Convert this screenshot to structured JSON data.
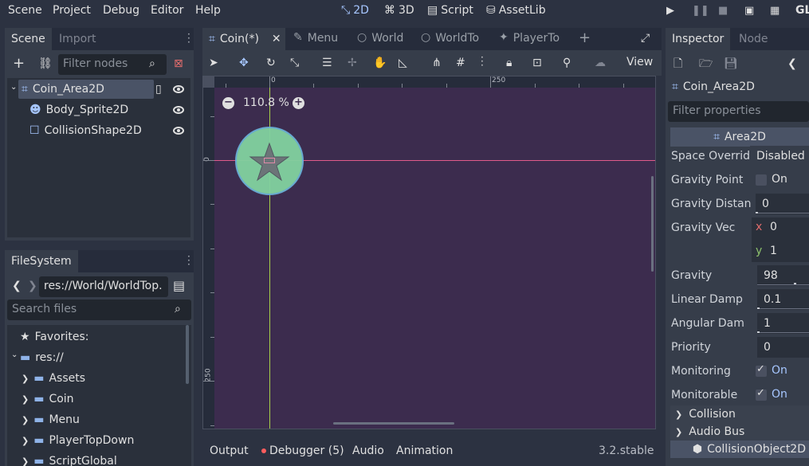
{
  "menu": [
    "Scene",
    "Project",
    "Debug",
    "Editor",
    "Help"
  ],
  "workspaces": [
    {
      "label": "2D",
      "icon": "2d-icon",
      "active": true
    },
    {
      "label": "3D",
      "icon": "3d-icon",
      "active": false
    },
    {
      "label": "Script",
      "icon": "script-icon",
      "active": false
    },
    {
      "label": "AssetLib",
      "icon": "assetlib-icon",
      "active": false
    }
  ],
  "renderer": "GL",
  "scene_dock": {
    "tabs": [
      "Scene",
      "Import"
    ],
    "filter_placeholder": "Filter nodes",
    "tree": [
      {
        "label": "Coin_Area2D",
        "depth": 0,
        "selected": true
      },
      {
        "label": "Body_Sprite2D",
        "depth": 1
      },
      {
        "label": "CollisionShape2D",
        "depth": 1
      }
    ]
  },
  "filesystem": {
    "tab": "FileSystem",
    "path": "res://World/WorldTop.",
    "search_placeholder": "Search files",
    "favorites": "Favorites:",
    "root": "res://",
    "folders": [
      "Assets",
      "Coin",
      "Menu",
      "PlayerTopDown",
      "ScriptGlobal"
    ]
  },
  "editor_tabs": [
    {
      "label": "Coin(*)",
      "active": true
    },
    {
      "label": "Menu",
      "active": false
    },
    {
      "label": "World",
      "active": false
    },
    {
      "label": "WorldTo",
      "active": false
    },
    {
      "label": "PlayerTo",
      "active": false
    }
  ],
  "toolbar": {
    "view_label": "View"
  },
  "viewport": {
    "zoom": "110.8 %",
    "ruler_top": [
      "0",
      "250"
    ],
    "ruler_left": [
      "0",
      "250"
    ]
  },
  "bottom": {
    "tabs": [
      "Output",
      "Debugger (5)",
      "Audio",
      "Animation"
    ],
    "version": "3.2.stable",
    "debugger_color": "#ff5d5d"
  },
  "inspector": {
    "tabs": [
      "Inspector",
      "Node"
    ],
    "node_name": "Coin_Area2D",
    "filter_placeholder": "Filter properties",
    "class_name": "Area2D",
    "props": {
      "space_override": {
        "label": "Space Overrid",
        "value": "Disabled"
      },
      "gravity_point": {
        "label": "Gravity Point",
        "value": "On"
      },
      "gravity_distance": {
        "label": "Gravity Distan",
        "value": "0"
      },
      "gravity_vec": {
        "label": "Gravity Vec",
        "x_label": "x",
        "x": "0",
        "y_label": "y",
        "y": "1"
      },
      "gravity": {
        "label": "Gravity",
        "value": "98"
      },
      "linear_damp": {
        "label": "Linear Damp",
        "value": "0.1"
      },
      "angular_damp": {
        "label": "Angular Dam",
        "value": "1"
      },
      "priority": {
        "label": "Priority",
        "value": "0"
      },
      "monitoring": {
        "label": "Monitoring",
        "value": "On"
      },
      "monitorable": {
        "label": "Monitorable",
        "value": "On"
      }
    },
    "sections": [
      "Collision",
      "Audio Bus"
    ],
    "footer_class": "CollisionObject2D"
  },
  "colors": {
    "accent": "#a6c6ff",
    "coin_fill": "#82d2a0",
    "axis_x": "#e05a8a",
    "axis_y": "#a8d04a"
  }
}
